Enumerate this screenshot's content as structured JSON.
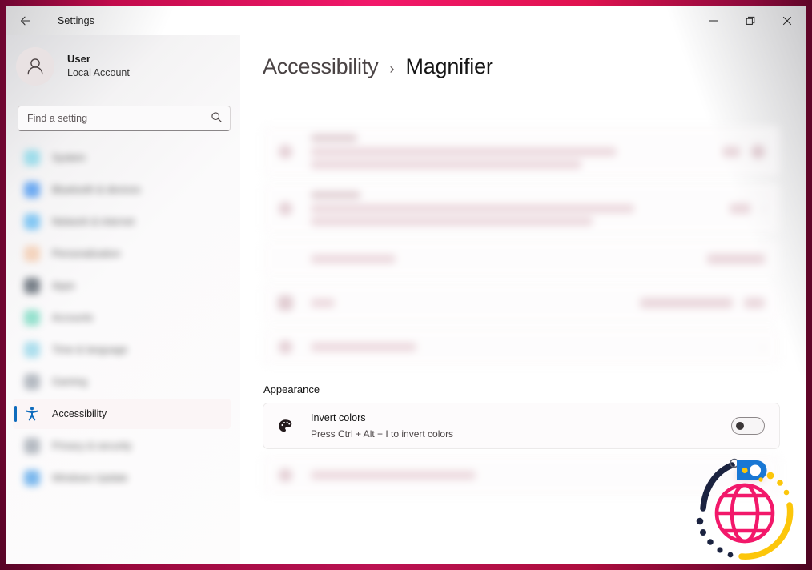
{
  "window": {
    "app_title": "Settings",
    "back_icon": "back-arrow-icon",
    "controls": {
      "minimize": "–",
      "restore": "❐",
      "close": "✕"
    }
  },
  "account": {
    "name": "User",
    "subtitle": "Local Account",
    "avatar_icon": "person-avatar-icon"
  },
  "search": {
    "placeholder": "Find a setting",
    "value": "",
    "icon": "search-icon"
  },
  "sidebar": {
    "items": [
      {
        "label": "System",
        "icon": "system-icon",
        "color": "#7fd5e8",
        "blurred": true,
        "selected": false
      },
      {
        "label": "Bluetooth & devices",
        "icon": "bluetooth-icon",
        "color": "#3b8ff0",
        "blurred": true,
        "selected": false
      },
      {
        "label": "Network & internet",
        "icon": "network-icon",
        "color": "#59b6f2",
        "blurred": true,
        "selected": false
      },
      {
        "label": "Personalization",
        "icon": "paintbrush-icon",
        "color": "#f3c7a8",
        "blurred": true,
        "selected": false
      },
      {
        "label": "Apps",
        "icon": "apps-icon",
        "color": "#4a5560",
        "blurred": true,
        "selected": false
      },
      {
        "label": "Accounts",
        "icon": "accounts-icon",
        "color": "#6fd8bd",
        "blurred": true,
        "selected": false
      },
      {
        "label": "Time & language",
        "icon": "clock-icon",
        "color": "#8fd4e8",
        "blurred": true,
        "selected": false
      },
      {
        "label": "Gaming",
        "icon": "gaming-icon",
        "color": "#9aa2ac",
        "blurred": true,
        "selected": false
      },
      {
        "label": "Accessibility",
        "icon": "accessibility-icon",
        "color": "#0f6cbd",
        "blurred": false,
        "selected": true
      },
      {
        "label": "Privacy & security",
        "icon": "shield-icon",
        "color": "#9aa2ac",
        "blurred": true,
        "selected": false
      },
      {
        "label": "Windows Update",
        "icon": "update-icon",
        "color": "#4b9fe8",
        "blurred": true,
        "selected": false
      }
    ]
  },
  "breadcrumb": {
    "root": "Accessibility",
    "separator": "›",
    "current": "Magnifier"
  },
  "main": {
    "blurred_cards": [
      {
        "id": "magnifier-toggle-card",
        "icon": "magnifier-icon",
        "title": "Magnifier",
        "subtitle": "Make everything on the screen bigger, press Win + Plus to turn on magnifier",
        "right": "toggle-on"
      },
      {
        "id": "zoom-level-card",
        "icon": "zoom-icon",
        "title": "Zoom level",
        "subtitle": "Change how much the magnifier enlarges the screen, press Ctrl + Alt + Plus to zoom in",
        "right": "value-chevron"
      },
      {
        "id": "zoom-increments-card",
        "icon": "",
        "title": "Zoom increments",
        "subtitle": "",
        "right": "value-dropdown"
      },
      {
        "id": "view-card",
        "icon": "view-icon",
        "title": "View",
        "subtitle": "",
        "right": "value-dropdown"
      },
      {
        "id": "start-magnifier-card",
        "icon": "settings-icon",
        "title": "Start magnifier",
        "subtitle": "",
        "right": "chevron"
      }
    ],
    "appearance": {
      "section_title": "Appearance",
      "invert": {
        "icon": "palette-icon",
        "title": "Invert colors",
        "subtitle": "Press Ctrl + Alt + I to invert colors",
        "toggle": "off"
      },
      "blurred_row": {
        "id": "smooth-edges-card",
        "icon": "smooth-icon",
        "title": "Smooth edges of images and text",
        "right": "toggle"
      }
    }
  },
  "overlay": {
    "name": "globe-cursor-badge",
    "globe_color": "#f2186a",
    "hook_color": "#1b2340",
    "cursor_color": "#1977d4",
    "arc_color": "#fcc60a"
  },
  "colors": {
    "frame_pink": "#f2186a",
    "frame_dark": "#6d0630",
    "accent_blue": "#0f6cbd",
    "text_primary": "#161616",
    "text_secondary": "#4c4647"
  }
}
